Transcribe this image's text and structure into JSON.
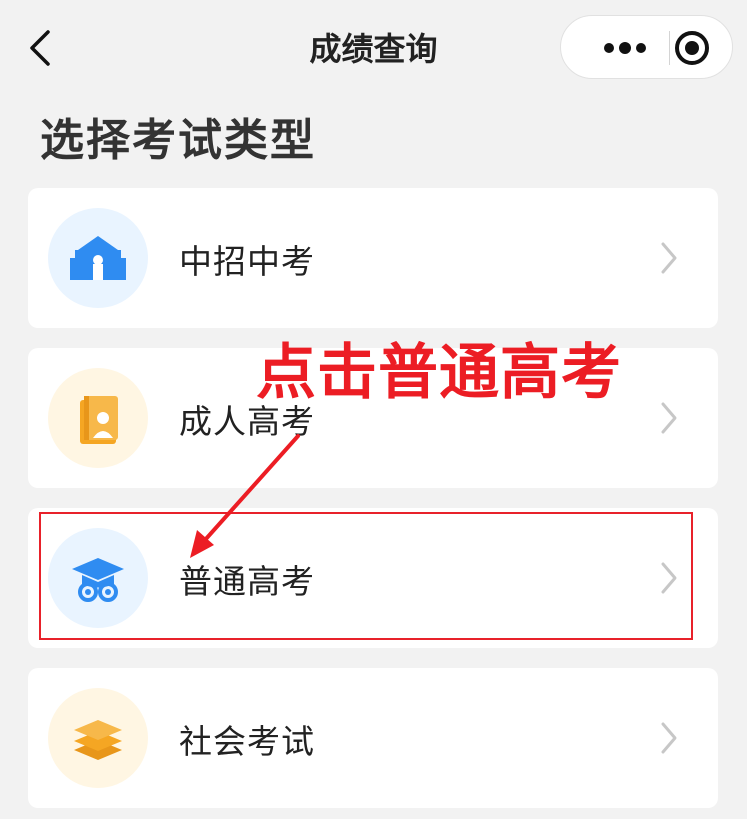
{
  "nav": {
    "title": "成绩查询",
    "back_icon": "chevron-left-icon",
    "more_icon": "more-dots-icon",
    "close_icon": "target-circle-icon"
  },
  "heading": "选择考试类型",
  "exam_types": [
    {
      "label": "中招中考",
      "icon": "school-building-icon",
      "icon_bg": "#e9f4ff",
      "icon_color": "#2f8cf1"
    },
    {
      "label": "成人高考",
      "icon": "book-person-icon",
      "icon_bg": "#fff6e3",
      "icon_color": "#f5a623"
    },
    {
      "label": "普通高考",
      "icon": "graduation-cap-icon",
      "icon_bg": "#e9f4ff",
      "icon_color": "#2f8cf1"
    },
    {
      "label": "社会考试",
      "icon": "stacked-layers-icon",
      "icon_bg": "#fff6e3",
      "icon_color": "#f5a623"
    }
  ],
  "annotation": {
    "text": "点击普通高考",
    "color": "#ec1d24"
  },
  "colors": {
    "background": "#f2f2f2",
    "card": "#ffffff",
    "chevron": "#c7c7c7"
  }
}
